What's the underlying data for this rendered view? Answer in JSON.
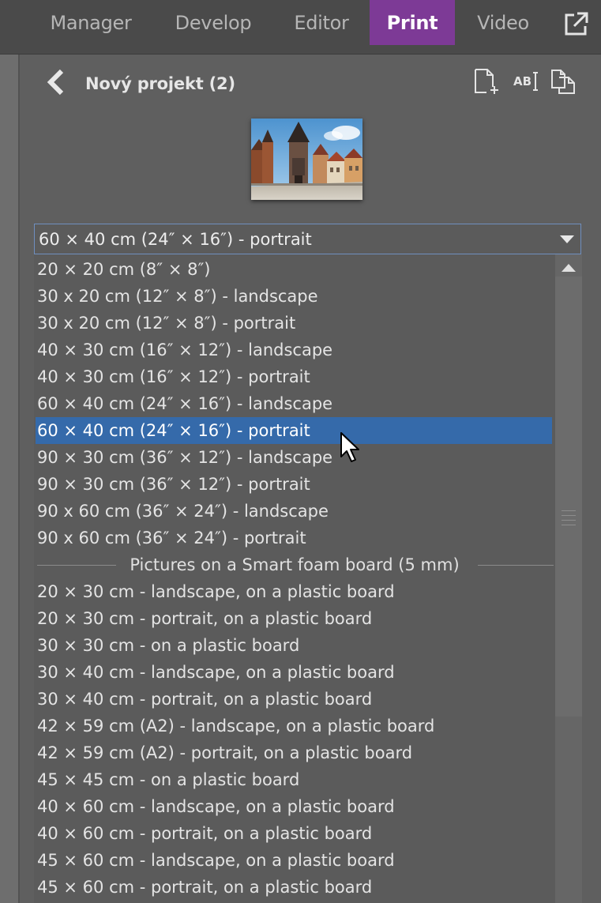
{
  "tabs": [
    {
      "label": "Manager",
      "active": false
    },
    {
      "label": "Develop",
      "active": false
    },
    {
      "label": "Editor",
      "active": false
    },
    {
      "label": "Print",
      "active": true
    },
    {
      "label": "Video",
      "active": false
    }
  ],
  "header": {
    "title": "Nový projekt (2)",
    "icons": [
      "new-page-icon",
      "text-edit-icon",
      "copy-pages-icon"
    ]
  },
  "format_select": {
    "value": "60 × 40 cm (24″ × 16″) - portrait"
  },
  "dropdown": {
    "options_photo": [
      "20 × 20 cm (8″ × 8″)",
      "30 x 20 cm (12″ × 8″) - landscape",
      "30 x 20 cm (12″ × 8″) - portrait",
      "40 × 30 cm (16″ × 12″) - landscape",
      "40 × 30 cm (16″ × 12″) - portrait",
      "60 × 40 cm (24″ × 16″) - landscape",
      "60 × 40 cm (24″ × 16″) - portrait",
      "90 × 30 cm (36″ × 12″) - landscape",
      "90 × 30 cm (36″ × 12″) - portrait",
      "90 x 60 cm (36″ × 24″) - landscape",
      "90 x 60 cm (36″ × 24″) - portrait"
    ],
    "selected_option": "60 × 40 cm (24″ × 16″) - portrait",
    "group_header": "Pictures on a Smart foam board (5 mm)",
    "options_board": [
      "20 × 30 cm - landscape, on a plastic board",
      "20 × 30 cm - portrait, on a plastic board",
      "30 × 30 cm - on a plastic board",
      "30 × 40 cm - landscape, on a plastic board",
      "30 × 40 cm - portrait, on a plastic board",
      "42 × 59 cm (A2) - landscape, on a plastic board",
      "42 × 59 cm (A2) - portrait, on a plastic board",
      "45 × 45 cm - on a plastic board",
      "40 × 60 cm - landscape, on a plastic board",
      "40 × 60 cm - portrait, on a plastic board",
      "45 × 60 cm - landscape, on a plastic board",
      "45 × 60 cm - portrait, on a plastic board"
    ]
  },
  "colors": {
    "accent_tab": "#7d3a96",
    "selection": "#356aaa",
    "panel_bg": "#5f5f5f"
  }
}
